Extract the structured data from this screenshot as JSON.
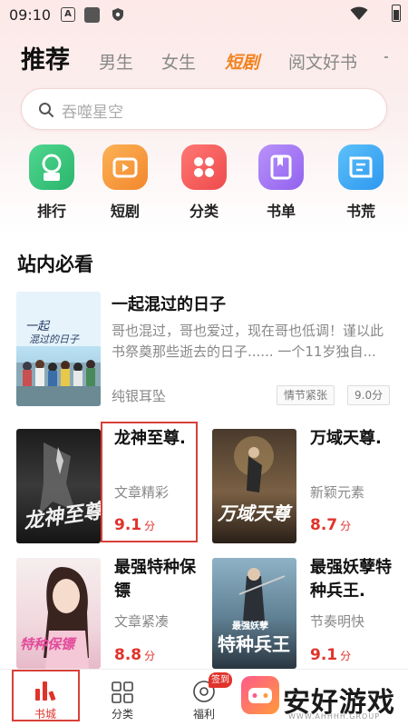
{
  "status_bar": {
    "time": "09:10",
    "a_icon_letter": "A"
  },
  "tabs": [
    {
      "label": "推荐"
    },
    {
      "label": "男生"
    },
    {
      "label": "女生"
    },
    {
      "label": "短剧"
    },
    {
      "label": "阅文好书"
    }
  ],
  "search": {
    "placeholder": "吞噬星空"
  },
  "shortcuts": [
    {
      "label": "排行",
      "color": "#35c07a"
    },
    {
      "label": "短剧",
      "color": "#f59a3b"
    },
    {
      "label": "分类",
      "color": "#f0585a"
    },
    {
      "label": "书单",
      "color": "#a679f0"
    },
    {
      "label": "书荒",
      "color": "#3aaaf0"
    }
  ],
  "section": {
    "title": "站内必看"
  },
  "featured": {
    "title": "一起混过的日子",
    "description": "哥也混过，哥也爱过，现在哥也低调！谨以此书祭奠那些逝去的日子...... 一个11岁独自...",
    "author": "纯银耳坠",
    "tags": [
      "情节紧张",
      "9.0分"
    ]
  },
  "books": [
    {
      "title": "龙神至尊.",
      "desc": "文章精彩",
      "score": "9.1",
      "unit": "分"
    },
    {
      "title": "万域天尊.",
      "desc": "新颖元素",
      "score": "8.7",
      "unit": "分"
    },
    {
      "title": "最强特种保镖",
      "desc": "文章紧凑",
      "score": "8.8",
      "unit": "分"
    },
    {
      "title": "最强妖孽特种兵王.",
      "desc": "节奏明快",
      "score": "9.1",
      "unit": "分"
    }
  ],
  "bottom_nav": [
    {
      "label": "书城",
      "active": true
    },
    {
      "label": "分类"
    },
    {
      "label": "福利"
    }
  ],
  "badge": {
    "text": "签到"
  },
  "watermark": {
    "text": "安好游戏",
    "sub": "WWW.AHHHH.GROUP"
  },
  "colors": {
    "accent": "#e0332b",
    "tab_hot": "#f2831f"
  }
}
